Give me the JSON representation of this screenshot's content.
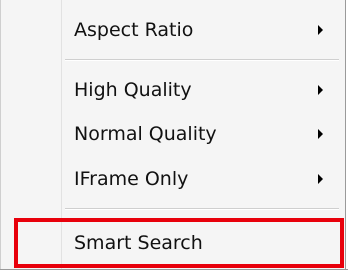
{
  "menu": {
    "items": [
      {
        "label": "Aspect Ratio",
        "submenu": true
      },
      {
        "label": "High Quality",
        "submenu": true
      },
      {
        "label": "Normal Quality",
        "submenu": true
      },
      {
        "label": "IFrame Only",
        "submenu": true
      },
      {
        "label": "Smart Search",
        "submenu": false,
        "highlighted": true
      }
    ]
  },
  "colors": {
    "menu_background": "#f5f5f5",
    "highlight_border": "#e8000b",
    "text": "#111111"
  }
}
